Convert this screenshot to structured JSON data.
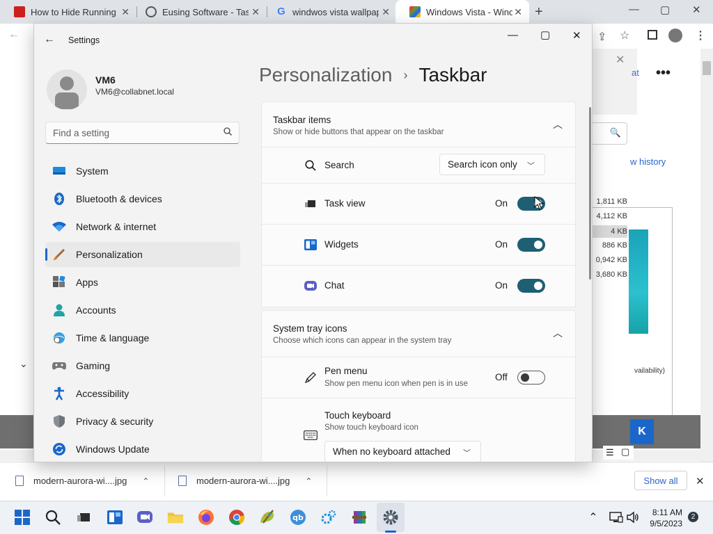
{
  "browser": {
    "tabs": [
      {
        "title": "How to Hide Running App",
        "favicon_color": "#cc1f1f"
      },
      {
        "title": "Eusing Software - Taskbar",
        "favicon_color": "#555555"
      },
      {
        "title": "windwos vista wallpaper",
        "favicon_color": "#4285f4"
      },
      {
        "title": "Windows Vista - Windows",
        "favicon_color": "#6a8f3a"
      }
    ],
    "new_tab": "+",
    "window_controls": {
      "minimize": "—",
      "maximize": "▢",
      "close": "✕"
    }
  },
  "background_page": {
    "more_label": "•••",
    "partial_link": "at",
    "history_link": "w history",
    "sizes": [
      "1,811 KB",
      "4,112 KB",
      "4 KB",
      "886 KB",
      "0,942 KB",
      "3,680 KB"
    ],
    "availability_text": "vailability)",
    "ok_label": "K"
  },
  "downloads": {
    "items": [
      {
        "filename": "modern-aurora-wi....jpg"
      },
      {
        "filename": "modern-aurora-wi....jpg"
      }
    ],
    "show_all": "Show all"
  },
  "taskbar": {
    "time": "8:11 AM",
    "date": "9/5/2023",
    "notification_count": "2",
    "pinned": [
      "start-icon",
      "search-icon",
      "task-view-icon",
      "widgets-icon",
      "chat-icon",
      "file-explorer-icon",
      "firefox-icon",
      "chrome-icon",
      "paint-icon",
      "qbittorrent-icon",
      "network-settings-icon",
      "winrar-icon",
      "settings-icon"
    ]
  },
  "settings": {
    "window_title": "Settings",
    "account": {
      "name": "VM6",
      "email": "VM6@collabnet.local"
    },
    "search_placeholder": "Find a setting",
    "nav": [
      {
        "label": "System",
        "icon": "monitor-icon",
        "selected": false
      },
      {
        "label": "Bluetooth & devices",
        "icon": "bluetooth-icon",
        "selected": false
      },
      {
        "label": "Network & internet",
        "icon": "wifi-icon",
        "selected": false
      },
      {
        "label": "Personalization",
        "icon": "brush-icon",
        "selected": true
      },
      {
        "label": "Apps",
        "icon": "apps-icon",
        "selected": false
      },
      {
        "label": "Accounts",
        "icon": "person-icon",
        "selected": false
      },
      {
        "label": "Time & language",
        "icon": "globe-clock-icon",
        "selected": false
      },
      {
        "label": "Gaming",
        "icon": "gamepad-icon",
        "selected": false
      },
      {
        "label": "Accessibility",
        "icon": "accessibility-icon",
        "selected": false
      },
      {
        "label": "Privacy & security",
        "icon": "shield-icon",
        "selected": false
      },
      {
        "label": "Windows Update",
        "icon": "update-icon",
        "selected": false
      }
    ],
    "breadcrumb": {
      "parent": "Personalization",
      "separator": "›",
      "current": "Taskbar"
    },
    "taskbar_items": {
      "title": "Taskbar items",
      "subtitle": "Show or hide buttons that appear on the taskbar",
      "rows": [
        {
          "label": "Search",
          "control": "dropdown",
          "value": "Search icon only"
        },
        {
          "label": "Task view",
          "state": "On",
          "on": true
        },
        {
          "label": "Widgets",
          "state": "On",
          "on": true
        },
        {
          "label": "Chat",
          "state": "On",
          "on": true
        }
      ]
    },
    "system_tray": {
      "title": "System tray icons",
      "subtitle": "Choose which icons can appear in the system tray",
      "pen_menu": {
        "label": "Pen menu",
        "description": "Show pen menu icon when pen is in use",
        "state": "Off",
        "on": false
      },
      "touch_keyboard": {
        "label": "Touch keyboard",
        "description": "Show touch keyboard icon",
        "value": "When no keyboard attached"
      }
    }
  },
  "colors": {
    "accent": "#1b67c9",
    "toggle_on": "#1e5f74"
  }
}
